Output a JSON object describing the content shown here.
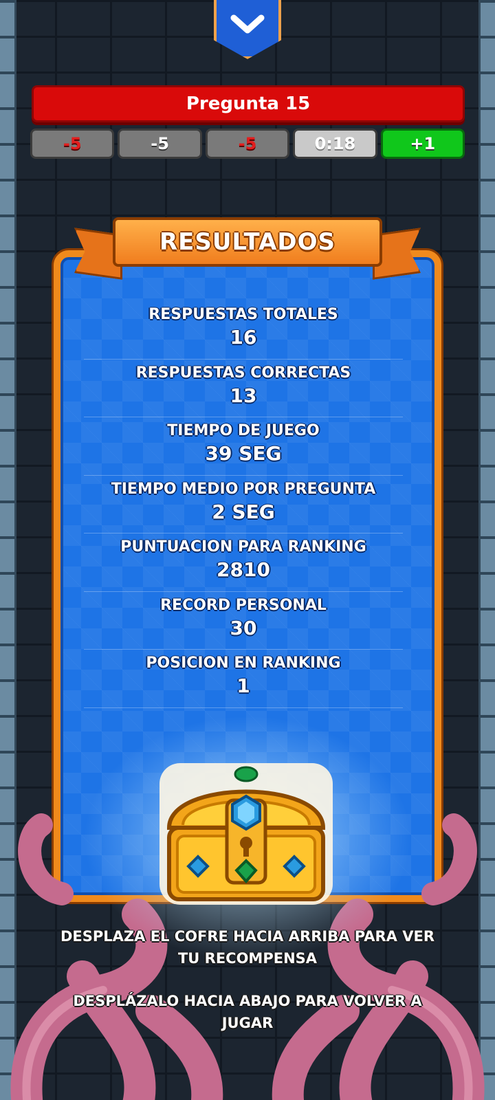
{
  "header": {
    "collapse_icon": "chevron-down-icon",
    "title": "Pregunta 15"
  },
  "stats": [
    {
      "text": "-5",
      "style": "grey-red"
    },
    {
      "text": "-5",
      "style": "grey-white"
    },
    {
      "text": "-5",
      "style": "grey-red"
    },
    {
      "text": "0:18",
      "style": "light-timer"
    },
    {
      "text": "+1",
      "style": "green"
    }
  ],
  "results_panel": {
    "title": "RESULTADOS",
    "rows": [
      {
        "label": "RESPUESTAS TOTALES",
        "value": "16"
      },
      {
        "label": "RESPUESTAS CORRECTAS",
        "value": "13"
      },
      {
        "label": "TIEMPO DE JUEGO",
        "value": "39 SEG"
      },
      {
        "label": "TIEMPO MEDIO POR PREGUNTA",
        "value": "2 SEG"
      },
      {
        "label": "PUNTUACION PARA RANKING",
        "value": "2810"
      },
      {
        "label": "RECORD PERSONAL",
        "value": "30"
      },
      {
        "label": "POSICION EN RANKING",
        "value": "1"
      }
    ]
  },
  "reward": {
    "chest_icon": "treasure-chest-icon"
  },
  "instructions": {
    "line_up": "DESPLAZA EL COFRE HACIA ARRIBA PARA VER TU RECOMPENSA",
    "line_down": "DESPLÁZALO HACIA ABAJO PARA VOLVER A JUGAR"
  },
  "colors": {
    "title_bar": "#d90a0a",
    "panel_blue": "#1e74e6",
    "panel_border": "#f08a1c",
    "bonus_green": "#10c71b"
  }
}
